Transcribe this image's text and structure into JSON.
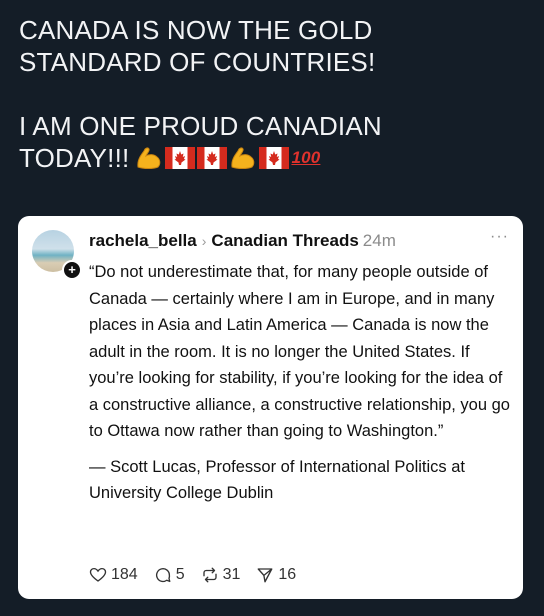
{
  "headline": {
    "line1": "CANADA IS NOW THE GOLD",
    "line2": "STANDARD OF COUNTRIES!",
    "line3": "I AM ONE PROUD CANADIAN",
    "line4": "TODAY!!!",
    "emojis": [
      "flexed-biceps",
      "canada-flag",
      "canada-flag",
      "flexed-biceps",
      "canada-flag",
      "hundred-points"
    ],
    "hundred_text": "100"
  },
  "post": {
    "username": "rachela_bella",
    "group": "Canadian Threads",
    "time": "24m",
    "more": "···",
    "quote": "“Do not underestimate that, for many people outside of Canada — certainly where I am in Europe, and in many places in Asia and Latin America — Canada is now the adult in the room. It is no longer the United States. If you’re looking for stability, if you’re looking for the idea of a constructive alliance, a constructive relationship, you go to Ottawa now rather than going to Washington.”",
    "attribution": "— Scott Lucas, Professor of International Politics at University College Dublin",
    "likes": "184",
    "replies": "5",
    "reposts": "31",
    "shares": "16"
  },
  "colors": {
    "background": "#141d27",
    "headline_text": "#f2f3f5",
    "card": "#ffffff",
    "flag_red": "#d52b1e"
  }
}
